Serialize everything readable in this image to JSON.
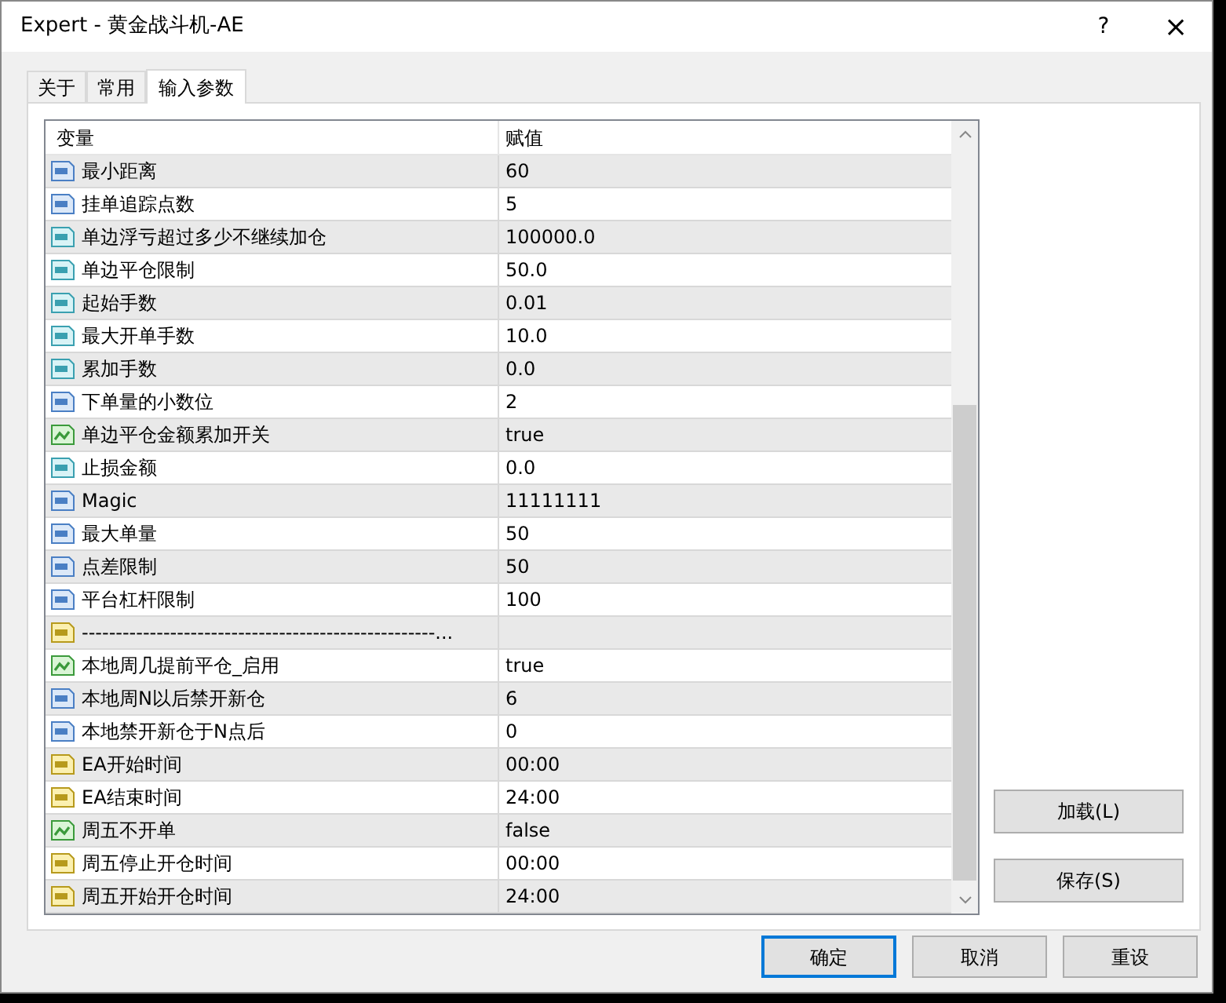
{
  "window": {
    "title": "Expert - 黄金战斗机-AE",
    "buttons": [
      "?",
      "×"
    ]
  },
  "tabs": [
    {
      "label": "关于",
      "selected": false
    },
    {
      "label": "常用",
      "selected": false
    },
    {
      "label": "输入参数",
      "selected": true
    }
  ],
  "table": {
    "columns": [
      "变量",
      "赋值"
    ],
    "rows": [
      {
        "kind": "int",
        "name": "最小距离",
        "value": "60"
      },
      {
        "kind": "int",
        "name": "挂单追踪点数",
        "value": "5"
      },
      {
        "kind": "double",
        "name": "单边浮亏超过多少不继续加仓",
        "value": "100000.0"
      },
      {
        "kind": "double",
        "name": "单边平仓限制",
        "value": "50.0"
      },
      {
        "kind": "double",
        "name": "起始手数",
        "value": "0.01"
      },
      {
        "kind": "double",
        "name": "最大开单手数",
        "value": "10.0"
      },
      {
        "kind": "double",
        "name": "累加手数",
        "value": "0.0"
      },
      {
        "kind": "int",
        "name": "下单量的小数位",
        "value": "2"
      },
      {
        "kind": "bool",
        "name": "单边平仓金额累加开关",
        "value": "true"
      },
      {
        "kind": "double",
        "name": "止损金额",
        "value": "0.0"
      },
      {
        "kind": "int",
        "name": "Magic",
        "value": "11111111"
      },
      {
        "kind": "int",
        "name": "最大单量",
        "value": "50"
      },
      {
        "kind": "int",
        "name": "点差限制",
        "value": "50"
      },
      {
        "kind": "int",
        "name": "平台杠杆限制",
        "value": "100"
      },
      {
        "kind": "string",
        "name": "----------------------------------------------------..."
      },
      {
        "kind": "bool",
        "name": "本地周几提前平仓_启用",
        "value": "true"
      },
      {
        "kind": "int",
        "name": "本地周N以后禁开新仓",
        "value": "6"
      },
      {
        "kind": "int",
        "name": "本地禁开新仓于N点后",
        "value": "0"
      },
      {
        "kind": "string",
        "name": "EA开始时间",
        "value": "00:00"
      },
      {
        "kind": "string",
        "name": "EA结束时间",
        "value": "24:00"
      },
      {
        "kind": "bool",
        "name": "周五不开单",
        "value": "false"
      },
      {
        "kind": "string",
        "name": "周五停止开仓时间",
        "value": "00:00"
      },
      {
        "kind": "string",
        "name": "周五开始开仓时间",
        "value": "24:00"
      }
    ]
  },
  "side_buttons": [
    "加载(L)",
    "保存(S)"
  ],
  "footer_buttons": [
    {
      "label": "确定",
      "selected": true
    },
    {
      "label": "取消",
      "selected": false
    },
    {
      "label": "重设",
      "selected": false
    }
  ]
}
